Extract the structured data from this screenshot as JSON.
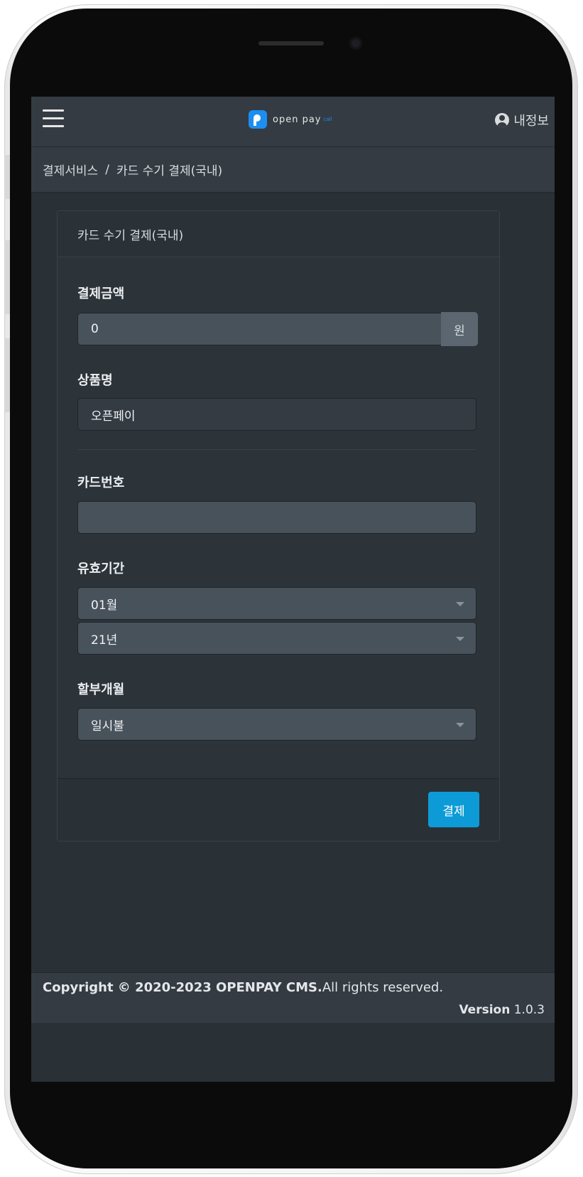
{
  "navbar": {
    "brand_text": "open pay",
    "brand_suffix": "call",
    "my_info": "내정보"
  },
  "breadcrumb": {
    "items": [
      "결제서비스",
      "카드 수기 결제(국내)"
    ],
    "separator": "/"
  },
  "card": {
    "title": "카드 수기 결제(국내)",
    "amount": {
      "label": "결제금액",
      "value": "0",
      "unit": "원"
    },
    "product": {
      "label": "상품명",
      "value": "오픈페이"
    },
    "card_number": {
      "label": "카드번호",
      "value": ""
    },
    "expiry": {
      "label": "유효기간",
      "month": "01월",
      "year": "21년"
    },
    "installment": {
      "label": "할부개월",
      "value": "일시불"
    },
    "pay_button": "결제"
  },
  "footer": {
    "copyright_bold": "Copyright © 2020-2023 OPENPAY CMS.",
    "copyright_rest": "All rights reserved.",
    "version_label": "Version",
    "version_value": "1.0.3"
  },
  "colors": {
    "accent": "#0c9bd6",
    "brand": "#1c8ef0",
    "background": "#293036"
  },
  "icons": {
    "menu": "hamburger-icon",
    "user": "user-circle-icon",
    "dropdown": "caret-down-icon"
  }
}
